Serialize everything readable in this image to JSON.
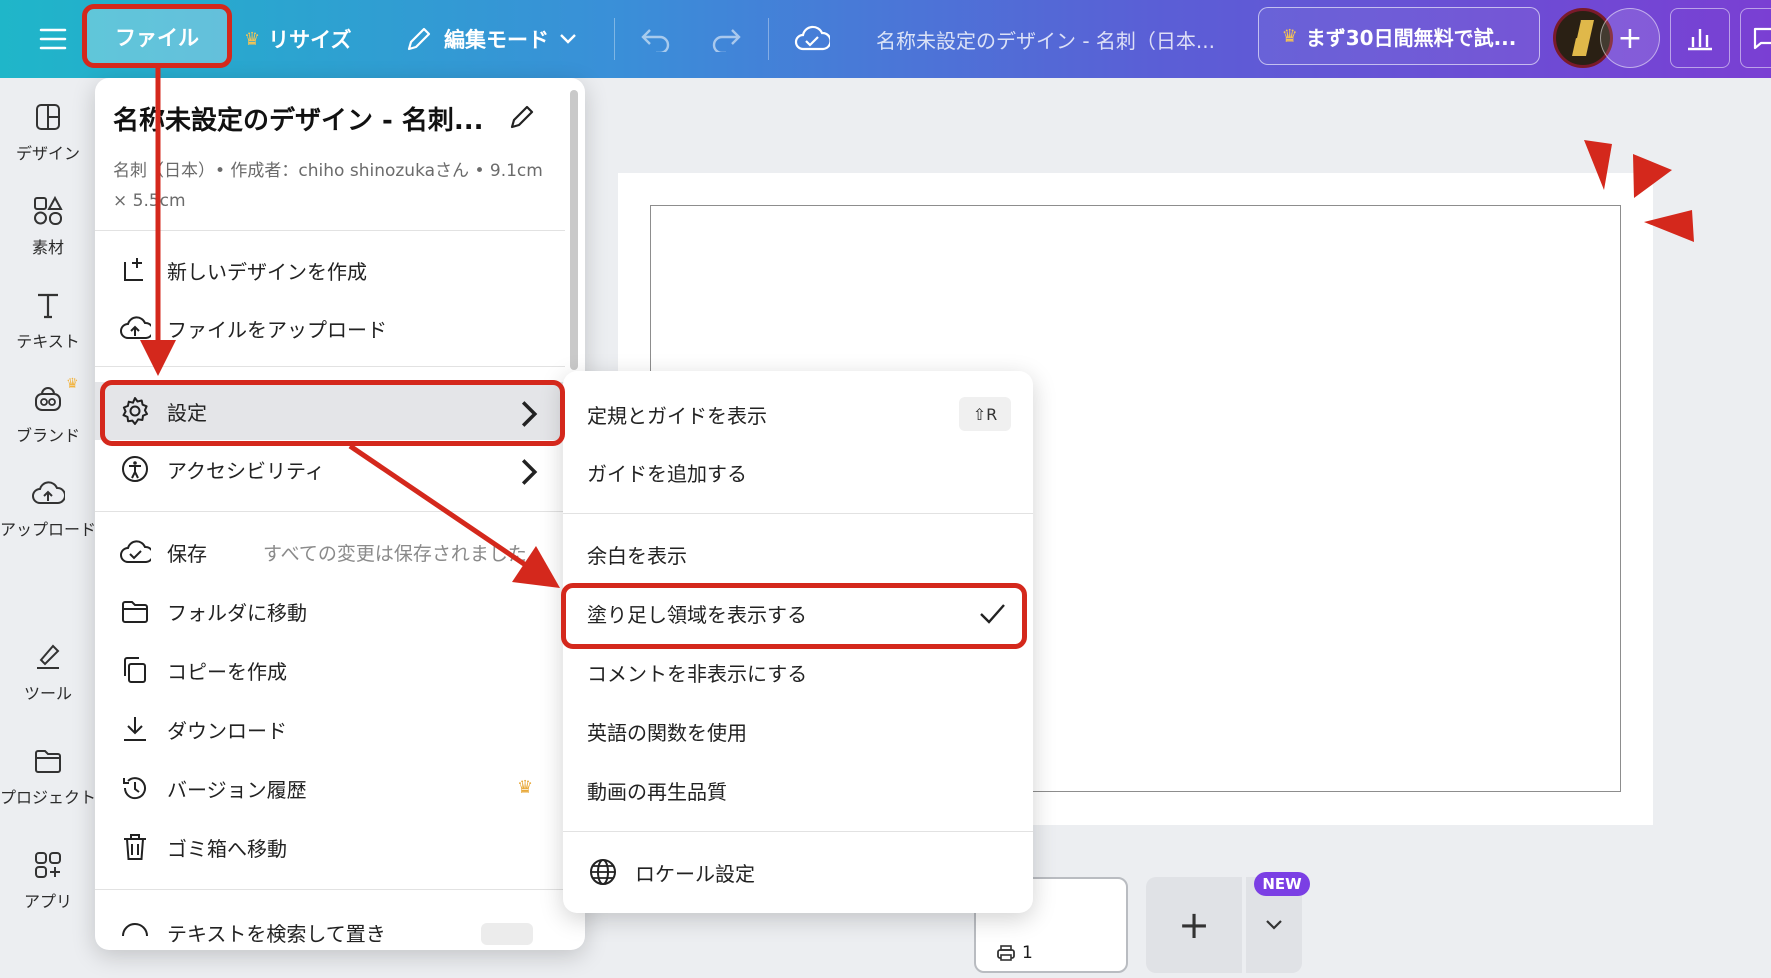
{
  "topbar": {
    "file_label": "ファイル",
    "resize_label": "リサイズ",
    "edit_mode_label": "編集モード",
    "doc_title": "名称未設定のデザイン - 名刺（日本...",
    "trial_label": "まず30日間無料で試..."
  },
  "rail": {
    "design": "デザイン",
    "elements": "素材",
    "text": "テキスト",
    "brand": "ブランド",
    "upload": "アップロード",
    "tools": "ツール",
    "projects": "プロジェクト",
    "apps": "アプリ"
  },
  "file_menu": {
    "title": "名称未設定のデザイン - 名刺...",
    "meta": "名刺（日本）• 作成者：chiho shinozukaさん • 9.1cm × 5.5cm",
    "items": {
      "new_design": "新しいデザインを作成",
      "upload": "ファイルをアップロード",
      "settings": "設定",
      "accessibility": "アクセシビリティ",
      "save": "保存",
      "save_status": "すべての変更は保存されました",
      "move_folder": "フォルダに移動",
      "make_copy": "コピーを作成",
      "download": "ダウンロード",
      "version_history": "バージョン履歴",
      "trash": "ゴミ箱へ移動",
      "find_replace": "テキストを検索して置き"
    }
  },
  "settings_menu": {
    "rulers": "定規とガイドを表示",
    "rulers_shortcut": "⇧R",
    "add_guide": "ガイドを追加する",
    "show_margins": "余白を表示",
    "show_bleed": "塗り足し領域を表示する",
    "hide_comments": "コメントを非表示にする",
    "english_functions": "英語の関数を使用",
    "video_quality": "動画の再生品質",
    "locale": "ロケール設定"
  },
  "bottom": {
    "page_number": "1",
    "new_badge": "NEW"
  },
  "colors": {
    "annotation_red": "#d4281c",
    "accent_purple": "#7b3fe4"
  }
}
